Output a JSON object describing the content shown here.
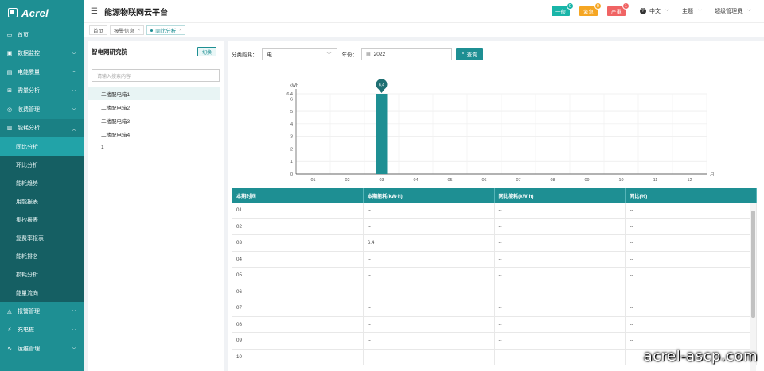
{
  "brand": {
    "logo_text": "Acrel"
  },
  "header": {
    "title": "能源物联网云平台",
    "alerts": [
      {
        "label": "一般",
        "count": "0",
        "color": "#19b5a8"
      },
      {
        "label": "紧急",
        "count": "0",
        "color": "#f5a623"
      },
      {
        "label": "严重",
        "count": "1",
        "color": "#f06464"
      }
    ],
    "language": "中文",
    "theme": "主题",
    "user": "超级管理员"
  },
  "sidebar": {
    "items_before": [
      {
        "label": "首页",
        "icon": "monitor-icon"
      },
      {
        "label": "数据监控",
        "icon": "screen-icon"
      },
      {
        "label": "电能质量",
        "icon": "meter-icon"
      },
      {
        "label": "需量分析",
        "icon": "cart-icon"
      },
      {
        "label": "收费管理",
        "icon": "user-icon"
      }
    ],
    "open_item": {
      "label": "能耗分析",
      "icon": "bar-chart-icon"
    },
    "sub_items": [
      {
        "label": "同比分析",
        "active": true
      },
      {
        "label": "环比分析"
      },
      {
        "label": "能耗趋势"
      },
      {
        "label": "用能报表"
      },
      {
        "label": "集抄报表"
      },
      {
        "label": "复费率报表"
      },
      {
        "label": "能耗排名"
      },
      {
        "label": "损耗分析"
      },
      {
        "label": "能量流向"
      }
    ],
    "items_after": [
      {
        "label": "报警管理",
        "icon": "alarm-icon"
      },
      {
        "label": "充电桩",
        "icon": "charger-icon"
      },
      {
        "label": "运维管理",
        "icon": "pulse-icon"
      }
    ]
  },
  "tabs": [
    {
      "label": "首页",
      "closable": false
    },
    {
      "label": "报警信息",
      "closable": true
    },
    {
      "label": "同比分析",
      "closable": true,
      "active": true
    }
  ],
  "tree": {
    "title": "智电网研究院",
    "switch_label": "切换",
    "search_placeholder": "请输入搜索内容",
    "nodes": [
      "二楼配电箱1",
      "二楼配电箱2",
      "二楼配电箱3",
      "二楼配电箱4",
      "1"
    ],
    "selected": 0
  },
  "filters": {
    "category_label": "分类能耗：",
    "category_value": "电",
    "year_label": "年份：",
    "year_value": "2022",
    "query_label": "查询"
  },
  "chart_data": {
    "type": "bar",
    "categories": [
      "01",
      "02",
      "03",
      "04",
      "05",
      "06",
      "07",
      "08",
      "09",
      "10",
      "11",
      "12"
    ],
    "values": [
      null,
      null,
      6.4,
      null,
      null,
      null,
      null,
      null,
      null,
      null,
      null,
      null
    ],
    "ylabel": "kWh",
    "xlabel": "月",
    "yticks": [
      0,
      1,
      2,
      3,
      4,
      5,
      6,
      6.4
    ],
    "ylim": [
      0,
      6.4
    ],
    "grid": true,
    "bar_color": "#1e8f93",
    "marker": {
      "category": "03",
      "label": "6.4"
    }
  },
  "table": {
    "headers": [
      "本期时间",
      "本期能耗(kW·h)",
      "同比能耗(kW·h)",
      "同比(%)"
    ],
    "rows": [
      [
        "01",
        "--",
        "--",
        "--"
      ],
      [
        "02",
        "--",
        "--",
        "--"
      ],
      [
        "03",
        "6.4",
        "--",
        "--"
      ],
      [
        "04",
        "--",
        "--",
        "--"
      ],
      [
        "05",
        "--",
        "--",
        "--"
      ],
      [
        "06",
        "--",
        "--",
        "--"
      ],
      [
        "07",
        "--",
        "--",
        "--"
      ],
      [
        "08",
        "--",
        "--",
        "--"
      ],
      [
        "09",
        "--",
        "--",
        "--"
      ],
      [
        "10",
        "--",
        "--",
        "--"
      ]
    ]
  },
  "watermark": "acrel-ascp.com"
}
